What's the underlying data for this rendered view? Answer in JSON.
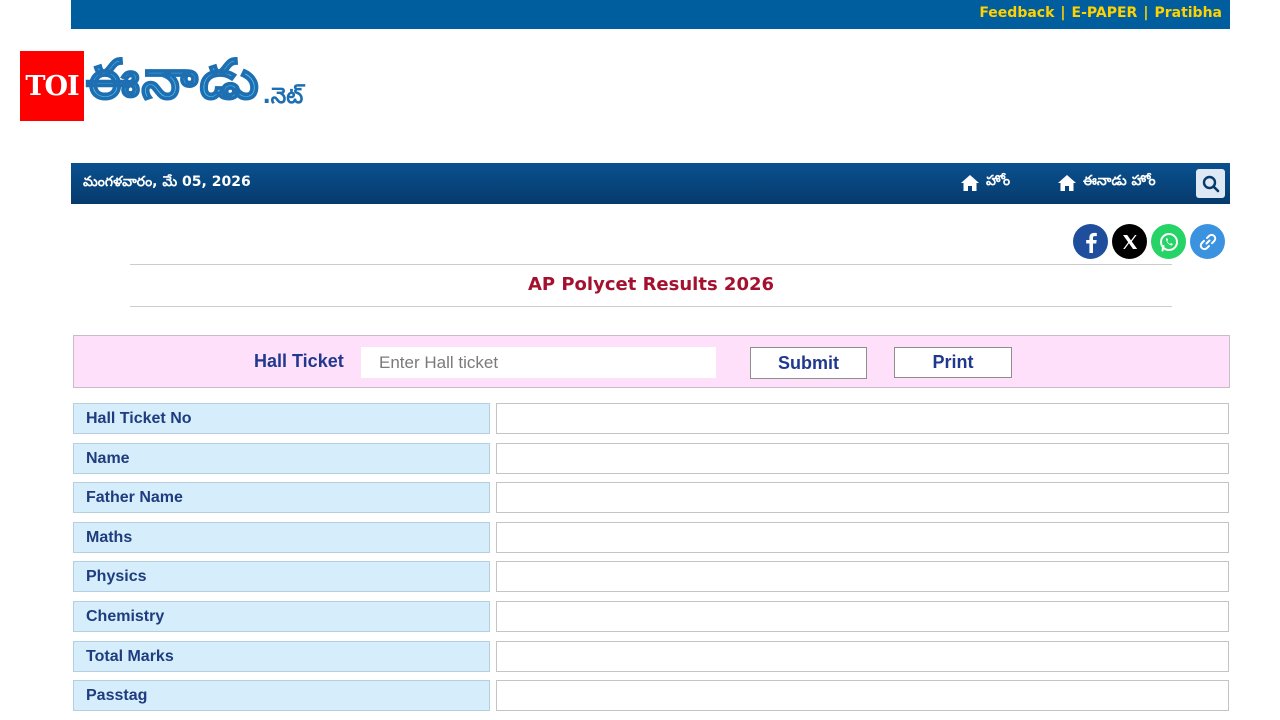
{
  "topbar": {
    "links": [
      "Feedback",
      "E-PAPER",
      "Pratibha"
    ],
    "separator": "|"
  },
  "toi_badge": "TOI",
  "logo": {
    "main": "ఈనాడు",
    "suffix": ".నెట్"
  },
  "nav": {
    "date": "మంగళవారం, మే 05, 2026",
    "home": "హోం",
    "eenadu_home": "ఈనాడు హోం"
  },
  "social": [
    "facebook-icon",
    "x-icon",
    "whatsapp-icon",
    "link-icon"
  ],
  "page_title": "AP Polycet Results 2026",
  "form": {
    "label": "Hall Ticket",
    "placeholder": "Enter Hall ticket",
    "value": "",
    "submit": "Submit",
    "print": "Print"
  },
  "result_rows": [
    {
      "label": "Hall Ticket No",
      "value": ""
    },
    {
      "label": "Name",
      "value": ""
    },
    {
      "label": "Father Name",
      "value": ""
    },
    {
      "label": "Maths",
      "value": ""
    },
    {
      "label": "Physics",
      "value": ""
    },
    {
      "label": "Chemistry",
      "value": ""
    },
    {
      "label": "Total Marks",
      "value": ""
    },
    {
      "label": "Passtag",
      "value": ""
    }
  ],
  "colors": {
    "topbar": "#005d9e",
    "topbar_link": "#ffd200",
    "navbar": "#063a6c",
    "title": "#a3112f",
    "form_bg": "#fee0fb",
    "label_bg": "#d6eefb"
  }
}
